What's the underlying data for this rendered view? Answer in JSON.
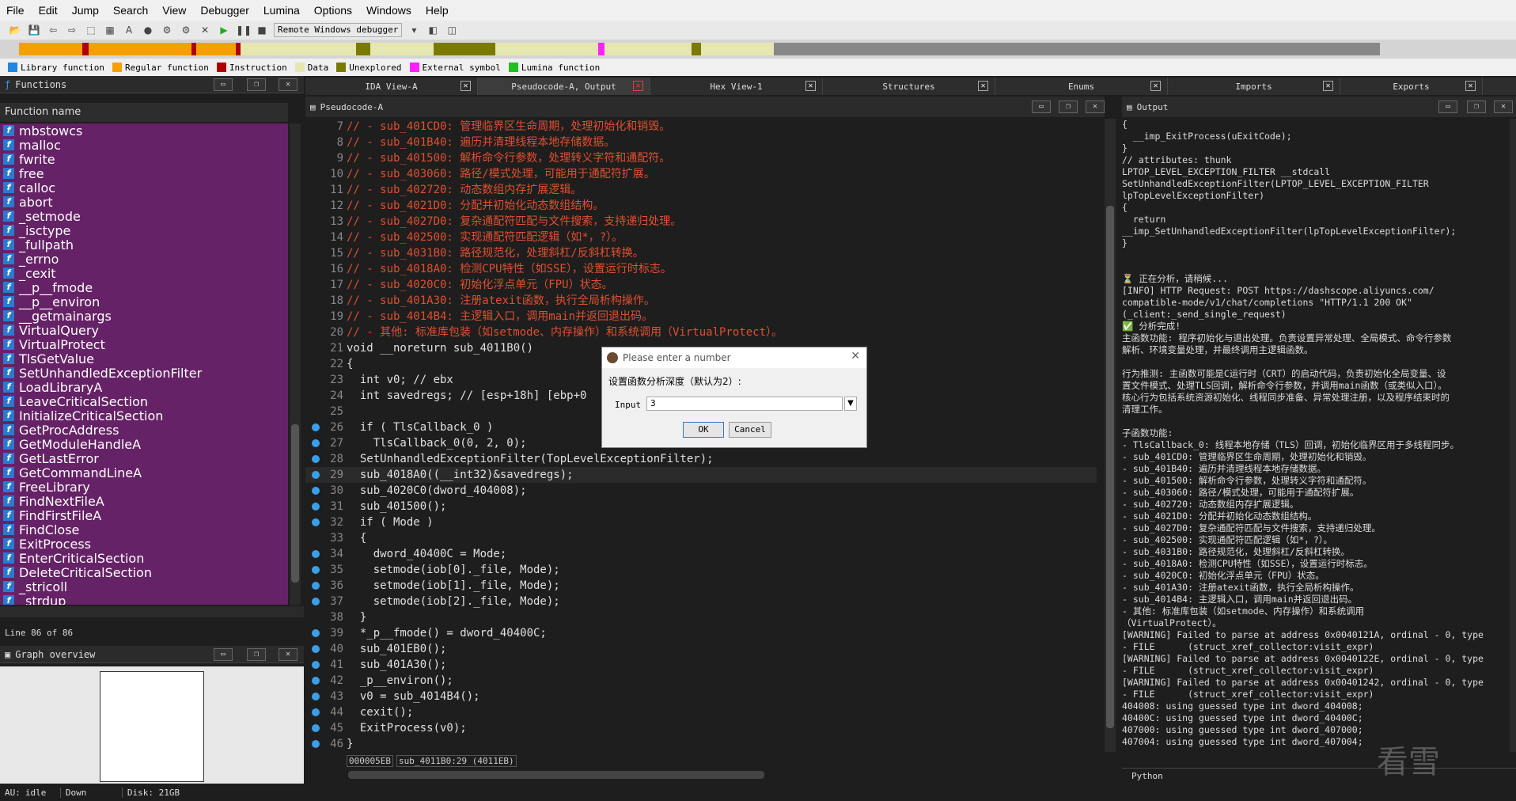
{
  "menu": [
    "File",
    "Edit",
    "Jump",
    "Search",
    "View",
    "Debugger",
    "Lumina",
    "Options",
    "Windows",
    "Help"
  ],
  "toolbar": {
    "debugger": "Remote Windows debugger"
  },
  "legend": [
    {
      "label": "Library function",
      "color": "#1e88e5"
    },
    {
      "label": "Regular function",
      "color": "#f5a000"
    },
    {
      "label": "Instruction",
      "color": "#b00000"
    },
    {
      "label": "Data",
      "color": "#e6e6b0"
    },
    {
      "label": "Unexplored",
      "color": "#7a7a00"
    },
    {
      "label": "External symbol",
      "color": "#ff20ff"
    },
    {
      "label": "Lumina function",
      "color": "#20c020"
    }
  ],
  "functions": {
    "title": "Functions",
    "column": "Function name",
    "items": [
      "mbstowcs",
      "malloc",
      "fwrite",
      "free",
      "calloc",
      "abort",
      "_setmode",
      "_isctype",
      "_fullpath",
      "_errno",
      "_cexit",
      "__p__fmode",
      "__p__environ",
      "__getmainargs",
      "VirtualQuery",
      "VirtualProtect",
      "TlsGetValue",
      "SetUnhandledExceptionFilter",
      "LoadLibraryA",
      "LeaveCriticalSection",
      "InitializeCriticalSection",
      "GetProcAddress",
      "GetModuleHandleA",
      "GetLastError",
      "GetCommandLineA",
      "FreeLibrary",
      "FindNextFileA",
      "FindFirstFileA",
      "FindClose",
      "ExitProcess",
      "EnterCriticalSection",
      "DeleteCriticalSection",
      "_stricoll",
      "_strdup"
    ],
    "status": "Line 86 of 86"
  },
  "graph_overview": {
    "title": "Graph overview"
  },
  "tabs": [
    "IDA View-A",
    "Pseudocode-A, Output",
    "Hex View-1",
    "Structures",
    "Enums",
    "Imports",
    "Exports"
  ],
  "pseudocode": {
    "title": "Pseudocode-A",
    "lines": [
      {
        "n": "7",
        "t": "// - sub_401CD0: 管理临界区生命周期，处理初始化和销毁。",
        "c": "cm",
        "dot": false
      },
      {
        "n": "8",
        "t": "// - sub_401B40: 遍历并清理线程本地存储数据。",
        "c": "cm",
        "dot": false
      },
      {
        "n": "9",
        "t": "// - sub_401500: 解析命令行参数，处理转义字符和通配符。",
        "c": "cm",
        "dot": false
      },
      {
        "n": "10",
        "t": "// - sub_403060: 路径/模式处理，可能用于通配符扩展。",
        "c": "cm",
        "dot": false
      },
      {
        "n": "11",
        "t": "// - sub_402720: 动态数组内存扩展逻辑。",
        "c": "cm",
        "dot": false
      },
      {
        "n": "12",
        "t": "// - sub_4021D0: 分配并初始化动态数组结构。",
        "c": "cm",
        "dot": false
      },
      {
        "n": "13",
        "t": "// - sub_4027D0: 复杂通配符匹配与文件搜索，支持递归处理。",
        "c": "cm",
        "dot": false
      },
      {
        "n": "14",
        "t": "// - sub_402500: 实现通配符匹配逻辑（如*，?）。",
        "c": "cm",
        "dot": false
      },
      {
        "n": "15",
        "t": "// - sub_4031B0: 路径规范化，处理斜杠/反斜杠转换。",
        "c": "cm",
        "dot": false
      },
      {
        "n": "16",
        "t": "// - sub_4018A0: 检测CPU特性（如SSE），设置运行时标志。",
        "c": "cm",
        "dot": false
      },
      {
        "n": "17",
        "t": "// - sub_4020C0: 初始化浮点单元（FPU）状态。",
        "c": "cm",
        "dot": false
      },
      {
        "n": "18",
        "t": "// - sub_401A30: 注册atexit函数，执行全局析构操作。",
        "c": "cm",
        "dot": false
      },
      {
        "n": "19",
        "t": "// - sub_4014B4: 主逻辑入口，调用main并返回退出码。",
        "c": "cm",
        "dot": false
      },
      {
        "n": "20",
        "t": "// - 其他: 标准库包装（如setmode、内存操作）和系统调用（VirtualProtect）。",
        "c": "cm",
        "dot": false
      },
      {
        "n": "21",
        "t": "void __noreturn sub_4011B0()",
        "c": "kw",
        "dot": false
      },
      {
        "n": "22",
        "t": "{",
        "c": "kw",
        "dot": false
      },
      {
        "n": "23",
        "t": "  int v0; // ebx",
        "c": "kw",
        "dot": false
      },
      {
        "n": "24",
        "t": "  int savedregs; // [esp+18h] [ebp+0",
        "c": "kw",
        "dot": false
      },
      {
        "n": "25",
        "t": "",
        "c": "kw",
        "dot": false
      },
      {
        "n": "26",
        "t": "  if ( TlsCallback_0 )",
        "c": "kw",
        "dot": true
      },
      {
        "n": "27",
        "t": "    TlsCallback_0(0, 2, 0);",
        "c": "kw",
        "dot": true
      },
      {
        "n": "28",
        "t": "  SetUnhandledExceptionFilter(TopLevelExceptionFilter);",
        "c": "kw",
        "dot": true
      },
      {
        "n": "29",
        "t": "  sub_4018A0((__int32)&savedregs);",
        "c": "kw",
        "dot": true
      },
      {
        "n": "30",
        "t": "  sub_4020C0(dword_404008);",
        "c": "kw",
        "dot": true
      },
      {
        "n": "31",
        "t": "  sub_401500();",
        "c": "kw",
        "dot": true
      },
      {
        "n": "32",
        "t": "  if ( Mode )",
        "c": "kw",
        "dot": true
      },
      {
        "n": "33",
        "t": "  {",
        "c": "kw",
        "dot": false
      },
      {
        "n": "34",
        "t": "    dword_40400C = Mode;",
        "c": "kw",
        "dot": true
      },
      {
        "n": "35",
        "t": "    setmode(iob[0]._file, Mode);",
        "c": "kw",
        "dot": true
      },
      {
        "n": "36",
        "t": "    setmode(iob[1]._file, Mode);",
        "c": "kw",
        "dot": true
      },
      {
        "n": "37",
        "t": "    setmode(iob[2]._file, Mode);",
        "c": "kw",
        "dot": true
      },
      {
        "n": "38",
        "t": "  }",
        "c": "kw",
        "dot": false
      },
      {
        "n": "39",
        "t": "  *_p__fmode() = dword_40400C;",
        "c": "kw",
        "dot": true
      },
      {
        "n": "40",
        "t": "  sub_401EB0();",
        "c": "kw",
        "dot": true
      },
      {
        "n": "41",
        "t": "  sub_401A30();",
        "c": "kw",
        "dot": true
      },
      {
        "n": "42",
        "t": "  _p__environ();",
        "c": "kw",
        "dot": true
      },
      {
        "n": "43",
        "t": "  v0 = sub_4014B4();",
        "c": "kw",
        "dot": true
      },
      {
        "n": "44",
        "t": "  cexit();",
        "c": "kw",
        "dot": true
      },
      {
        "n": "45",
        "t": "  ExitProcess(v0);",
        "c": "kw",
        "dot": true
      },
      {
        "n": "46",
        "t": "}",
        "c": "kw",
        "dot": true
      }
    ],
    "status_addr": "000005EB",
    "status_loc": "sub_4011B0:29 (4011EB)"
  },
  "output": {
    "title": "Output",
    "lines": [
      "{",
      "  __imp_ExitProcess(uExitCode);",
      "}",
      "// attributes: thunk",
      "LPTOP_LEVEL_EXCEPTION_FILTER __stdcall",
      "SetUnhandledExceptionFilter(LPTOP_LEVEL_EXCEPTION_FILTER",
      "lpTopLevelExceptionFilter)",
      "{",
      "  return",
      "__imp_SetUnhandledExceptionFilter(lpTopLevelExceptionFilter);",
      "}",
      "",
      "",
      "⏳ 正在分析，请稍候...",
      "[INFO] HTTP Request: POST https://dashscope.aliyuncs.com/",
      "compatible-mode/v1/chat/completions \"HTTP/1.1 200 OK\"",
      "(_client:_send_single_request)",
      "✅ 分析完成!",
      "主函数功能: 程序初始化与退出处理。负责设置异常处理、全局模式、命令行参数",
      "解析、环境变量处理，并最终调用主逻辑函数。",
      "",
      "行为推测: 主函数可能是C运行时（CRT）的启动代码，负责初始化全局变量、设",
      "置文件模式、处理TLS回调，解析命令行参数，并调用main函数（或类似入口）。",
      "核心行为包括系统资源初始化、线程同步准备、异常处理注册，以及程序结束时的",
      "清理工作。",
      "",
      "子函数功能:",
      "- TlsCallback_0: 线程本地存储（TLS）回调，初始化临界区用于多线程同步。",
      "- sub_401CD0: 管理临界区生命周期，处理初始化和销毁。",
      "- sub_401B40: 遍历并清理线程本地存储数据。",
      "- sub_401500: 解析命令行参数，处理转义字符和通配符。",
      "- sub_403060: 路径/模式处理，可能用于通配符扩展。",
      "- sub_402720: 动态数组内存扩展逻辑。",
      "- sub_4021D0: 分配并初始化动态数组结构。",
      "- sub_4027D0: 复杂通配符匹配与文件搜索，支持递归处理。",
      "- sub_402500: 实现通配符匹配逻辑（如*，?）。",
      "- sub_4031B0: 路径规范化，处理斜杠/反斜杠转换。",
      "- sub_4018A0: 检测CPU特性（如SSE），设置运行时标志。",
      "- sub_4020C0: 初始化浮点单元（FPU）状态。",
      "- sub_401A30: 注册atexit函数，执行全局析构操作。",
      "- sub_4014B4: 主逻辑入口，调用main并返回退出码。",
      "- 其他: 标准库包装（如setmode、内存操作）和系统调用",
      "（VirtualProtect）。",
      "[WARNING] Failed to parse at address 0x0040121A, ordinal - 0, type",
      "- FILE      (struct_xref_collector:visit_expr)",
      "[WARNING] Failed to parse at address 0x0040122E, ordinal - 0, type",
      "- FILE      (struct_xref_collector:visit_expr)",
      "[WARNING] Failed to parse at address 0x00401242, ordinal - 0, type",
      "- FILE      (struct_xref_collector:visit_expr)",
      "404008: using guessed type int dword_404008;",
      "40400C: using guessed type int dword_40400C;",
      "407000: using guessed type int dword_407000;",
      "407004: using guessed type int dword_407004;"
    ],
    "python_tab": "Python"
  },
  "dialog": {
    "title": "Please enter a number",
    "prompt": "设置函数分析深度（默认为2）:",
    "input_label": "Input",
    "input_value": "3",
    "ok": "OK",
    "cancel": "Cancel"
  },
  "status": {
    "au": "AU:",
    "state": "idle",
    "dir": "Down",
    "disk": "Disk: 21GB"
  },
  "watermark": "看雪"
}
